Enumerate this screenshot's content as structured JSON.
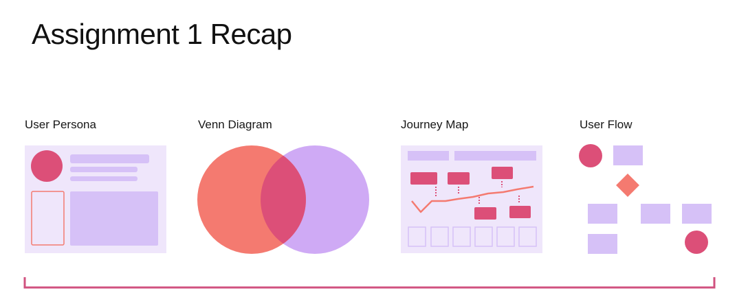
{
  "slide": {
    "title": "Assignment 1 Recap"
  },
  "items": [
    {
      "label": "User Persona"
    },
    {
      "label": "Venn Diagram"
    },
    {
      "label": "Journey Map"
    },
    {
      "label": "User Flow"
    }
  ],
  "colors": {
    "lavender_bg": "#efe6fb",
    "lavender_block": "#d6c1f7",
    "purple": "#cfaaf5",
    "salmon": "#f47a70",
    "rose": "#dc4f78",
    "bracket": "#d0527f"
  }
}
